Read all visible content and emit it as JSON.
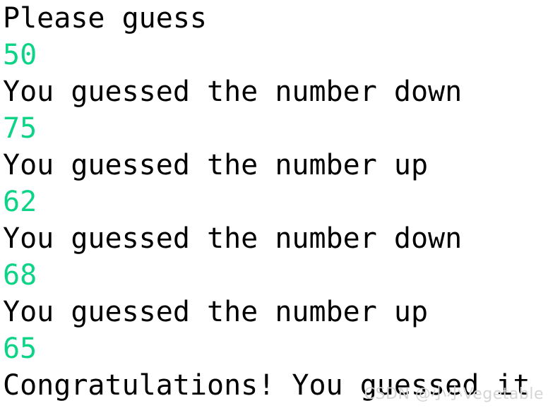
{
  "console": {
    "background_color": "#ffffff",
    "output_color": "#000000",
    "input_color": "#0bd486",
    "lines": [
      {
        "text": "Please guess",
        "kind": "output"
      },
      {
        "text": "50",
        "kind": "input"
      },
      {
        "text": "You guessed the number down",
        "kind": "output"
      },
      {
        "text": "75",
        "kind": "input"
      },
      {
        "text": "You guessed the number up",
        "kind": "output"
      },
      {
        "text": "62",
        "kind": "input"
      },
      {
        "text": "You guessed the number down",
        "kind": "output"
      },
      {
        "text": "68",
        "kind": "input"
      },
      {
        "text": "You guessed the number up",
        "kind": "output"
      },
      {
        "text": "65",
        "kind": "input"
      },
      {
        "text": "Congratulations! You guessed it",
        "kind": "output"
      }
    ]
  },
  "watermark": {
    "text": "CSDN @小小Vegetable",
    "color": "#d5d5d5"
  }
}
